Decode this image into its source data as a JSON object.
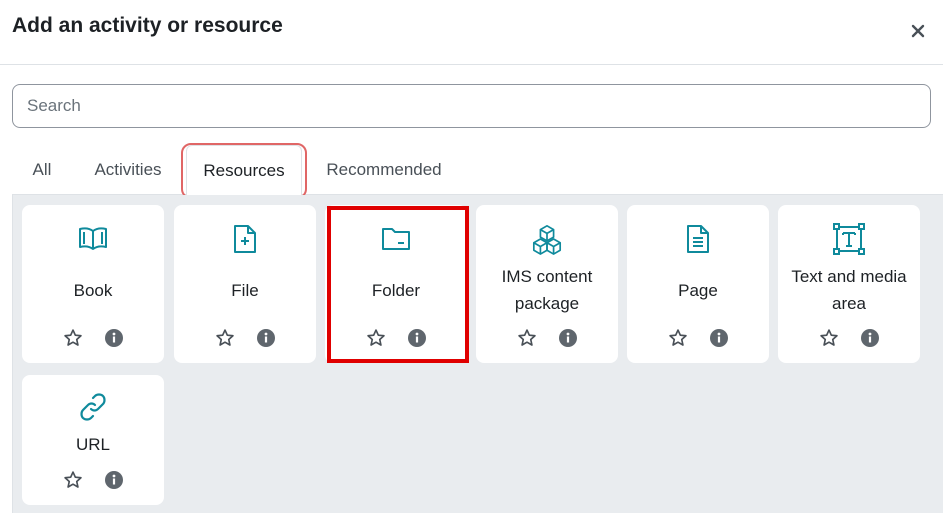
{
  "modal": {
    "title": "Add an activity or resource",
    "close_label": "×"
  },
  "search": {
    "placeholder": "Search",
    "value": ""
  },
  "tabs": [
    {
      "label": "All",
      "active": false
    },
    {
      "label": "Activities",
      "active": false
    },
    {
      "label": "Resources",
      "active": true
    },
    {
      "label": "Recommended",
      "active": false
    }
  ],
  "items": [
    {
      "name": "Book",
      "icon": "book-icon"
    },
    {
      "name": "File",
      "icon": "file-plus-icon"
    },
    {
      "name": "Folder",
      "icon": "folder-icon"
    },
    {
      "name": "IMS content package",
      "icon": "cubes-icon"
    },
    {
      "name": "Page",
      "icon": "page-icon"
    },
    {
      "name": "Text and media area",
      "icon": "text-frame-icon"
    },
    {
      "name": "URL",
      "icon": "link-icon"
    }
  ],
  "colors": {
    "icon_teal": "#0f8a9c",
    "highlight_red": "#e00000",
    "tab_highlight": "#e06666"
  }
}
